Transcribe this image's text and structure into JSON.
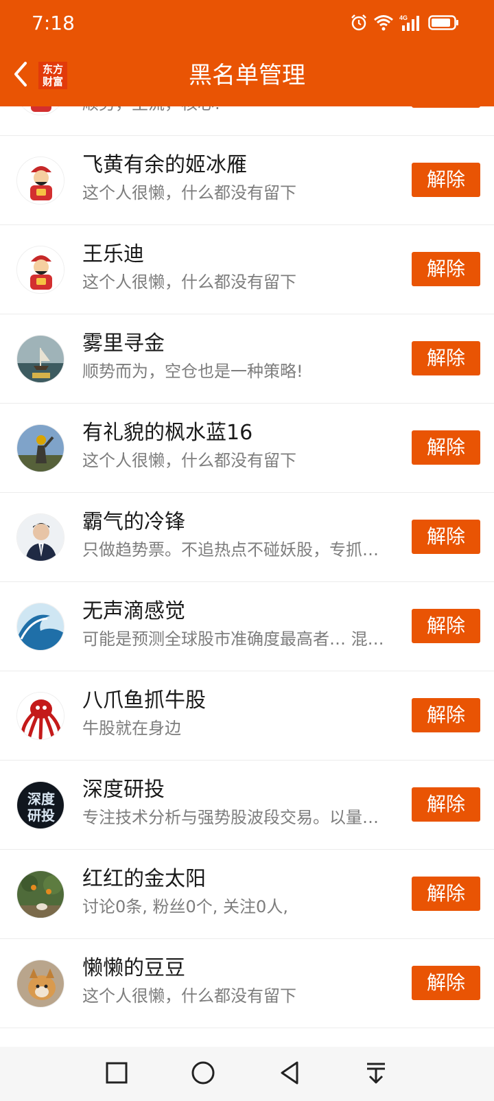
{
  "status": {
    "time": "7:18",
    "network": "4G"
  },
  "header": {
    "title": "黑名单管理",
    "logo_line1": "东方",
    "logo_line2": "财富"
  },
  "partial_row": {
    "subtitle": "顺势，主流，核心!"
  },
  "button_label": "解除",
  "rows": [
    {
      "name": "飞黄有余的姬冰雁",
      "subtitle": "这个人很懒，什么都没有留下",
      "avatar": "caishen-avatar"
    },
    {
      "name": "王乐迪",
      "subtitle": "这个人很懒，什么都没有留下",
      "avatar": "caishen-avatar"
    },
    {
      "name": "雾里寻金",
      "subtitle": "顺势而为，空仓也是一种策略!",
      "avatar": "ship-avatar"
    },
    {
      "name": "有礼貌的枫水蓝16",
      "subtitle": "这个人很懒，什么都没有留下",
      "avatar": "soldier-avatar"
    },
    {
      "name": "霸气的冷锋",
      "subtitle": "只做趋势票。不追热点不碰妖股，专抓…",
      "avatar": "man-suit-avatar"
    },
    {
      "name": "无声滴感觉",
      "subtitle": "可能是预测全球股市准确度最高者… 混…",
      "avatar": "wave-avatar"
    },
    {
      "name": "八爪鱼抓牛股",
      "subtitle": "牛股就在身边",
      "avatar": "octopus-avatar"
    },
    {
      "name": "深度研投",
      "subtitle": "专注技术分析与强势股波段交易。以量…",
      "avatar": "text-logo-avatar",
      "avatar_text_1": "深度",
      "avatar_text_2": "研投"
    },
    {
      "name": "红红的金太阳",
      "subtitle": "讨论0条, 粉丝0个, 关注0人,",
      "avatar": "garden-avatar"
    },
    {
      "name": "懒懒的豆豆",
      "subtitle": "这个人很懒，什么都没有留下",
      "avatar": "dog-avatar"
    }
  ],
  "colors": {
    "accent": "#e95404",
    "background": "#ffffff",
    "divider": "#ececec",
    "subtext": "#7d7d7d"
  },
  "navbar": {
    "icons": [
      "recents-square-icon",
      "home-circle-icon",
      "back-triangle-icon",
      "notification-pull-down-icon"
    ]
  }
}
